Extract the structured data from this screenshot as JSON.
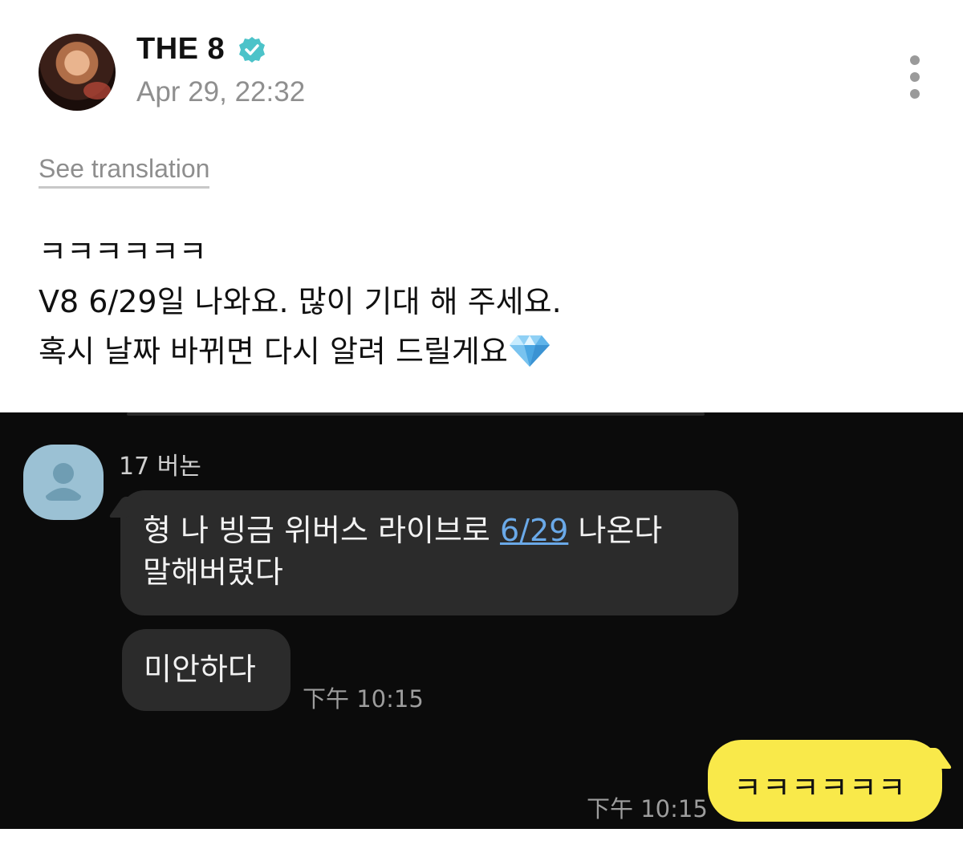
{
  "post": {
    "author": "THE 8",
    "date": "Apr 29, 22:32",
    "see_translation": "See translation",
    "body_lines": [
      "ㅋㅋㅋㅋㅋㅋ",
      "V8 6/29일 나와요. 많이 기대 해 주세요.",
      "혹시 날짜 바뀌면 다시 알려 드릴게요"
    ],
    "icons": {
      "verified": "verified-badge-icon",
      "more": "more-vertical-icon",
      "emoji": "gem-stone-emoji"
    },
    "colors": {
      "verified": "#4cc3c9",
      "muted": "#8f8f8f"
    }
  },
  "chat": {
    "sender": "17 버논",
    "messages": [
      {
        "from": "other",
        "text_before": "형 나 빙금 위버스 라이브로 ",
        "link": "6/29",
        "text_after": " 나온다",
        "line2": "말해버렸다"
      },
      {
        "from": "other",
        "text": "미안하다",
        "time": "下午 10:15"
      },
      {
        "from": "me",
        "text": "ㅋㅋㅋㅋㅋㅋ",
        "time": "下午 10:15"
      }
    ],
    "colors": {
      "background": "#0b0b0b",
      "bubble_other": "#2b2b2b",
      "bubble_me": "#f9e94a",
      "link": "#6aa9e8"
    }
  }
}
